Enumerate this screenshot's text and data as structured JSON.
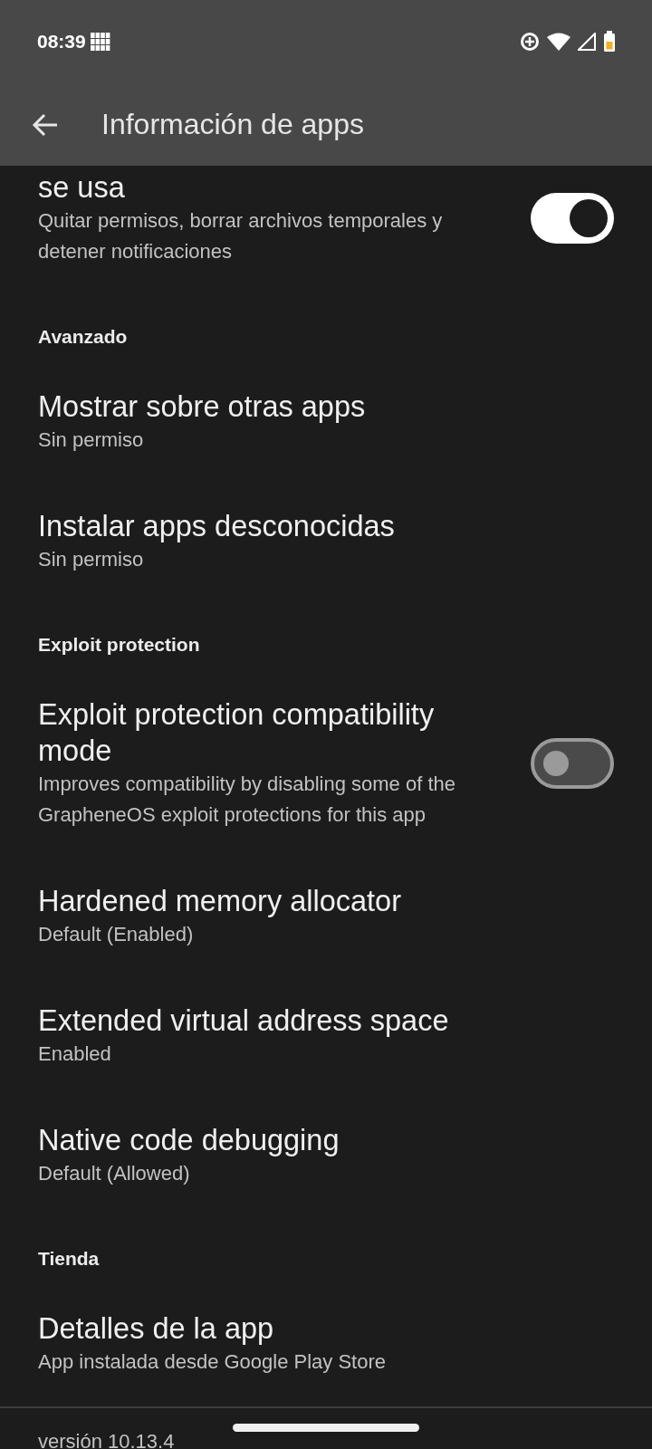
{
  "status_bar": {
    "time": "08:39"
  },
  "app_bar": {
    "title": "Información de apps"
  },
  "list": [
    {
      "kind": "toggle",
      "title": "se usa",
      "subtitle": "Quitar permisos, borrar archivos temporales y detener notificaciones",
      "checked": true
    },
    {
      "kind": "header",
      "title": "Avanzado"
    },
    {
      "kind": "item",
      "title": "Mostrar sobre otras apps",
      "subtitle": "Sin permiso"
    },
    {
      "kind": "item",
      "title": "Instalar apps desconocidas",
      "subtitle": "Sin permiso"
    },
    {
      "kind": "header",
      "title": "Exploit protection"
    },
    {
      "kind": "toggle",
      "title": "Exploit protection compatibility mode",
      "subtitle": "Improves compatibility by disabling some of the GrapheneOS exploit protections for this app",
      "checked": false
    },
    {
      "kind": "item",
      "title": "Hardened memory allocator",
      "subtitle": "Default (Enabled)"
    },
    {
      "kind": "item",
      "title": "Extended virtual address space",
      "subtitle": "Enabled"
    },
    {
      "kind": "item",
      "title": "Native code debugging",
      "subtitle": "Default (Allowed)"
    },
    {
      "kind": "header",
      "title": "Tienda"
    },
    {
      "kind": "item",
      "title": "Detalles de la app",
      "subtitle": "App instalada desde Google Play Store"
    }
  ],
  "footer": {
    "version": "versión 10.13.4"
  }
}
